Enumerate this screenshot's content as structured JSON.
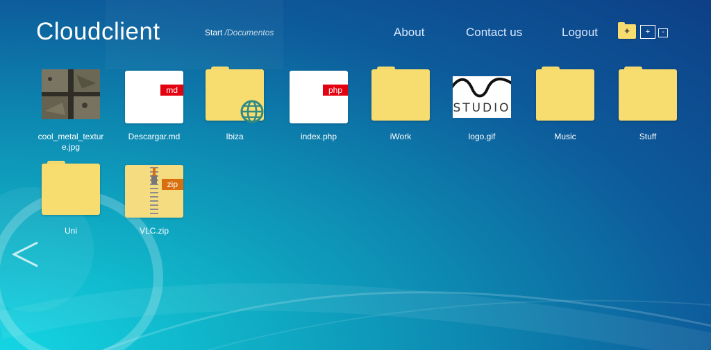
{
  "header": {
    "app_title": "Cloudclient",
    "breadcrumb": {
      "start": "Start",
      "separator": " /",
      "current": "Documentos"
    },
    "nav": {
      "about": "About",
      "contact": "Contact us",
      "logout": "Logout"
    },
    "tools": {
      "new_folder": "+",
      "zoom_in": "+",
      "zoom_out": "-"
    }
  },
  "items": [
    {
      "name": "cool_metal_texture.jpg",
      "kind": "image-texture"
    },
    {
      "name": "Descargar.md",
      "kind": "file",
      "badge": "md",
      "badge_color": "#e3000f"
    },
    {
      "name": "Ibiza",
      "kind": "folder-web"
    },
    {
      "name": "index.php",
      "kind": "file",
      "badge": "php",
      "badge_color": "#e3000f"
    },
    {
      "name": "iWork",
      "kind": "folder"
    },
    {
      "name": "logo.gif",
      "kind": "image-logo",
      "logo_text": "STUDIO"
    },
    {
      "name": "Music",
      "kind": "folder"
    },
    {
      "name": "Stuff",
      "kind": "folder"
    },
    {
      "name": "Uni",
      "kind": "folder"
    },
    {
      "name": "VLC.zip",
      "kind": "zip",
      "badge": "zip",
      "badge_color": "#d9700f"
    }
  ],
  "colors": {
    "folder": "#f7dc6f",
    "accent_red": "#e3000f",
    "zip_badge": "#d9700f"
  },
  "icons": {
    "back": "chevron-left-icon",
    "web": "globe-icon",
    "new_folder": "folder-plus-icon"
  }
}
